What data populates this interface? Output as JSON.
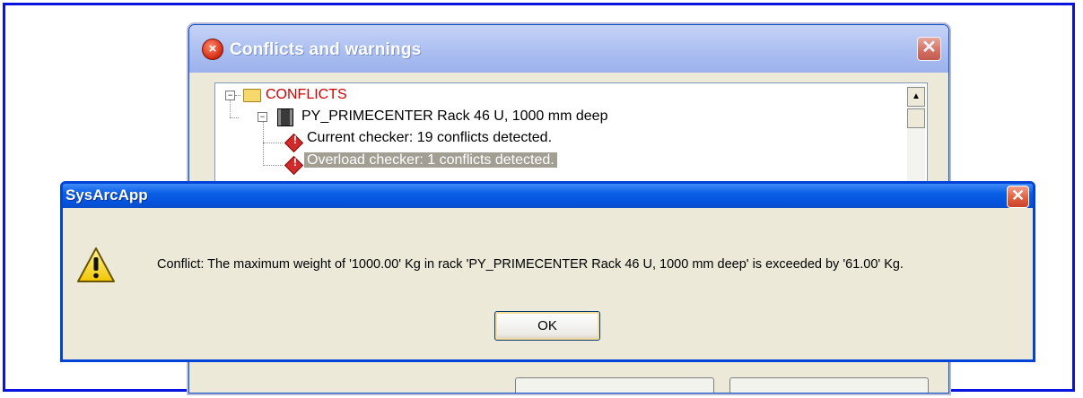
{
  "back_dialog": {
    "title": "Conflicts and warnings",
    "close_glyph": "✕",
    "icon": "error-icon",
    "tree": {
      "root": {
        "label": "CONFLICTS",
        "expander": "−",
        "icon": "folder-icon"
      },
      "rack": {
        "label": "PY_PRIMECENTER Rack 46 U, 1000 mm deep",
        "expander": "−",
        "icon": "rack-icon"
      },
      "items": [
        {
          "label": "Current checker: 19 conflicts detected.",
          "icon": "warning-diamond-icon",
          "selected": false
        },
        {
          "label": "Overload checker: 1 conflicts detected.",
          "icon": "warning-diamond-icon",
          "selected": true
        }
      ]
    },
    "scroll_up_glyph": "▲"
  },
  "message_box": {
    "title": "SysArcApp",
    "close_glyph": "✕",
    "icon": "warning-triangle-icon",
    "message": "Conflict: The maximum weight of '1000.00' Kg in rack 'PY_PRIMECENTER Rack 46 U, 1000 mm deep' is exceeded by '61.00' Kg.",
    "ok_label": "OK"
  },
  "colors": {
    "frame_border": "#0a14e0",
    "conflicts_text": "#d00000",
    "titlebar_blue": "#0552dc",
    "dialog_bg": "#ece9d8"
  }
}
